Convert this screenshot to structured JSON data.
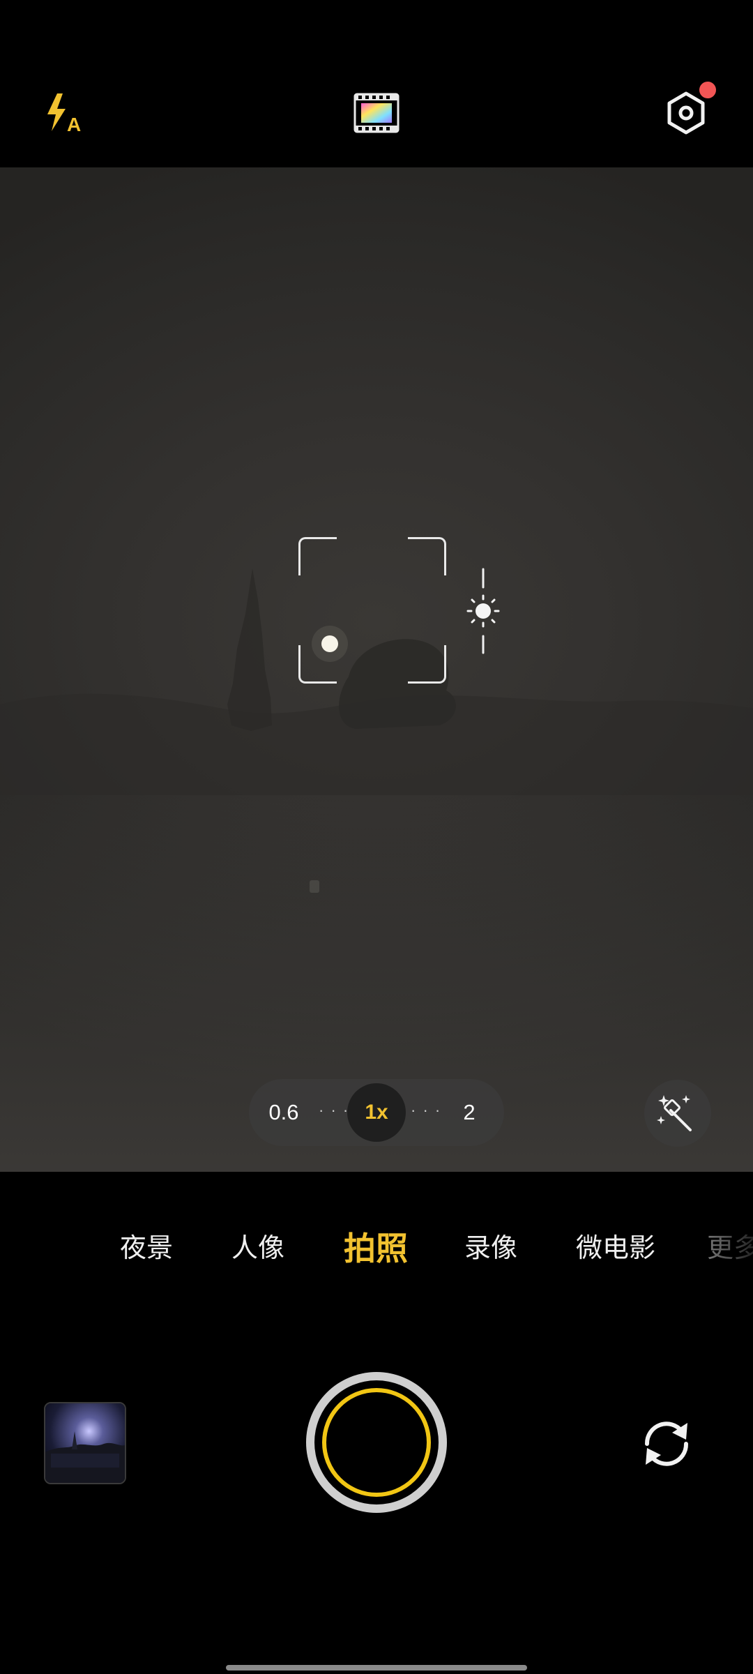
{
  "top_bar": {
    "flash_icon": "flash-auto-icon",
    "filter_icon": "filter-film-icon",
    "settings_icon": "settings-hexagon-icon",
    "settings_badge": true
  },
  "viewfinder": {
    "focus_icon": "focus-frame-icon",
    "exposure_icon": "exposure-sun-icon",
    "magic_icon": "magic-wand-icon",
    "zoom": {
      "options": [
        "0.6",
        "1x",
        "2"
      ],
      "active": "1x"
    }
  },
  "modes": {
    "items": [
      "夜景",
      "人像",
      "拍照",
      "录像",
      "微电影",
      "更多"
    ],
    "active": "拍照"
  },
  "bottom": {
    "gallery_icon": "gallery-thumbnail",
    "shutter_icon": "shutter-button",
    "switch_icon": "switch-camera-icon"
  },
  "colors": {
    "accent": "#f2c230",
    "shutter_ring": "#f2c614",
    "badge": "#f25555",
    "background": "#000000"
  }
}
